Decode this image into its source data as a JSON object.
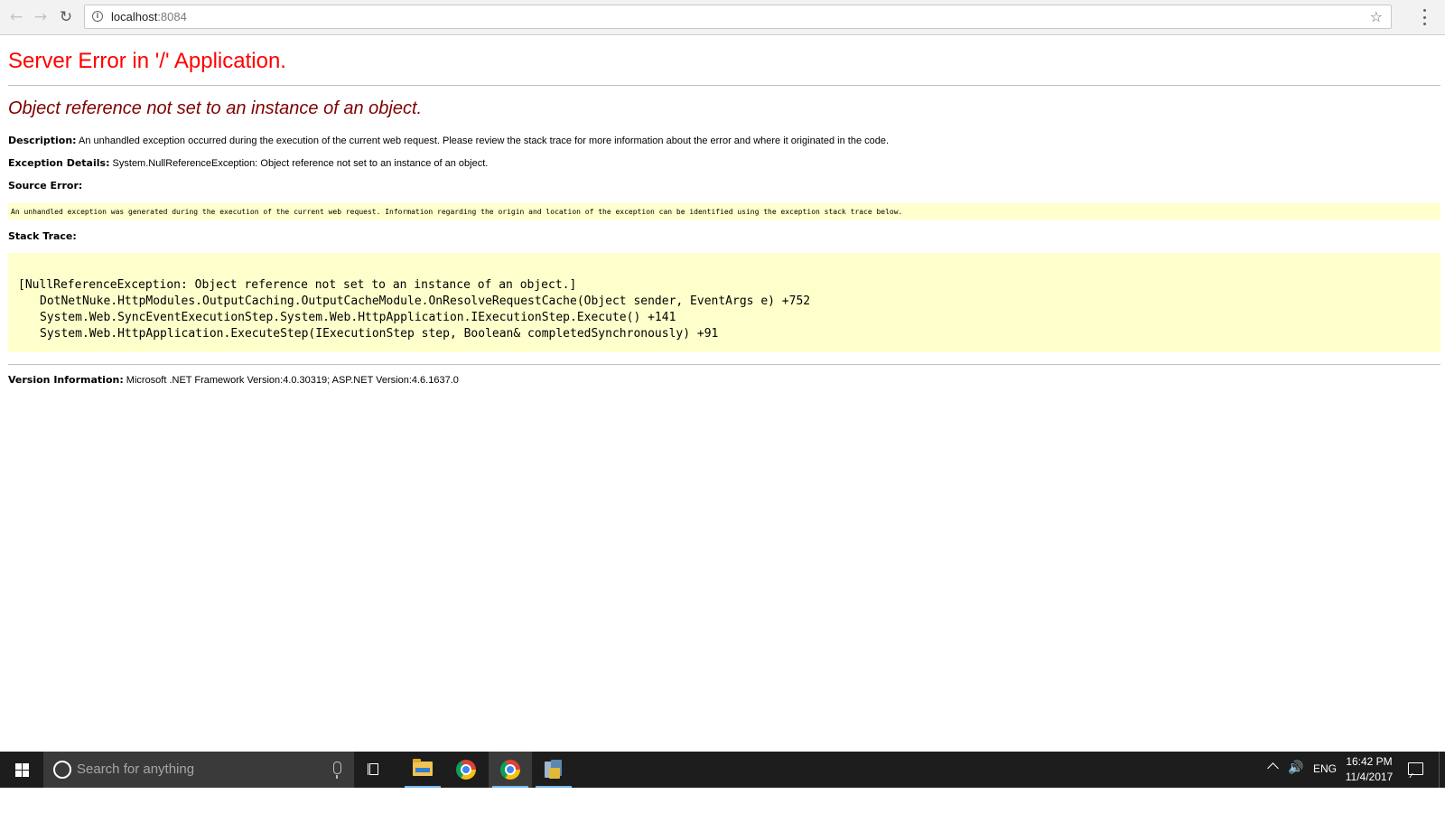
{
  "browser": {
    "url_host": "localhost",
    "url_port": ":8084"
  },
  "page": {
    "heading": "Server Error in '/' Application.",
    "exception_title": "Object reference not set to an instance of an object.",
    "description_label": "Description:",
    "description_text": "An unhandled exception occurred during the execution of the current web request. Please review the stack trace for more information about the error and where it originated in the code.",
    "exception_details_label": "Exception Details:",
    "exception_details_text": "System.NullReferenceException: Object reference not set to an instance of an object.",
    "source_error_label": "Source Error:",
    "source_error_text": "An unhandled exception was generated during the execution of the current web request. Information regarding the origin and location of the exception can be identified using the exception stack trace below.",
    "stack_trace_label": "Stack Trace:",
    "stack_trace": {
      "header": "[NullReferenceException: Object reference not set to an instance of an object.]",
      "frames": [
        "DotNetNuke.HttpModules.OutputCaching.OutputCacheModule.OnResolveRequestCache(Object sender, EventArgs e) +752",
        "System.Web.SyncEventExecutionStep.System.Web.HttpApplication.IExecutionStep.Execute() +141",
        "System.Web.HttpApplication.ExecuteStep(IExecutionStep step, Boolean& completedSynchronously) +91"
      ]
    },
    "version_label": "Version Information:",
    "version_text": "Microsoft .NET Framework Version:4.0.30319; ASP.NET Version:4.6.1637.0"
  },
  "taskbar": {
    "search_placeholder": "Search for anything",
    "language": "ENG",
    "time": "16:42 PM",
    "date": "11/4/2017"
  },
  "colors": {
    "heading": "#ff0000",
    "exception_title": "#800000",
    "code_background": "#ffffcc",
    "taskbar": "#1d1d1d",
    "active_underline": "#76b9ed"
  },
  "icons": {
    "back": "arrow-left-icon",
    "forward": "arrow-right-icon",
    "reload": "reload-icon",
    "site_info": "info-icon",
    "bookmark": "star-icon",
    "browser_menu": "three-dots-vertical-icon",
    "start": "windows-logo-icon",
    "cortana": "cortana-circle-icon",
    "microphone": "microphone-icon",
    "task_view": "task-view-icon",
    "file_explorer": "folder-icon",
    "chrome": "chrome-icon",
    "iis_manager": "iis-manager-icon",
    "tray_overflow": "chevron-up-icon",
    "volume": "speaker-icon",
    "action_center": "notification-icon"
  }
}
